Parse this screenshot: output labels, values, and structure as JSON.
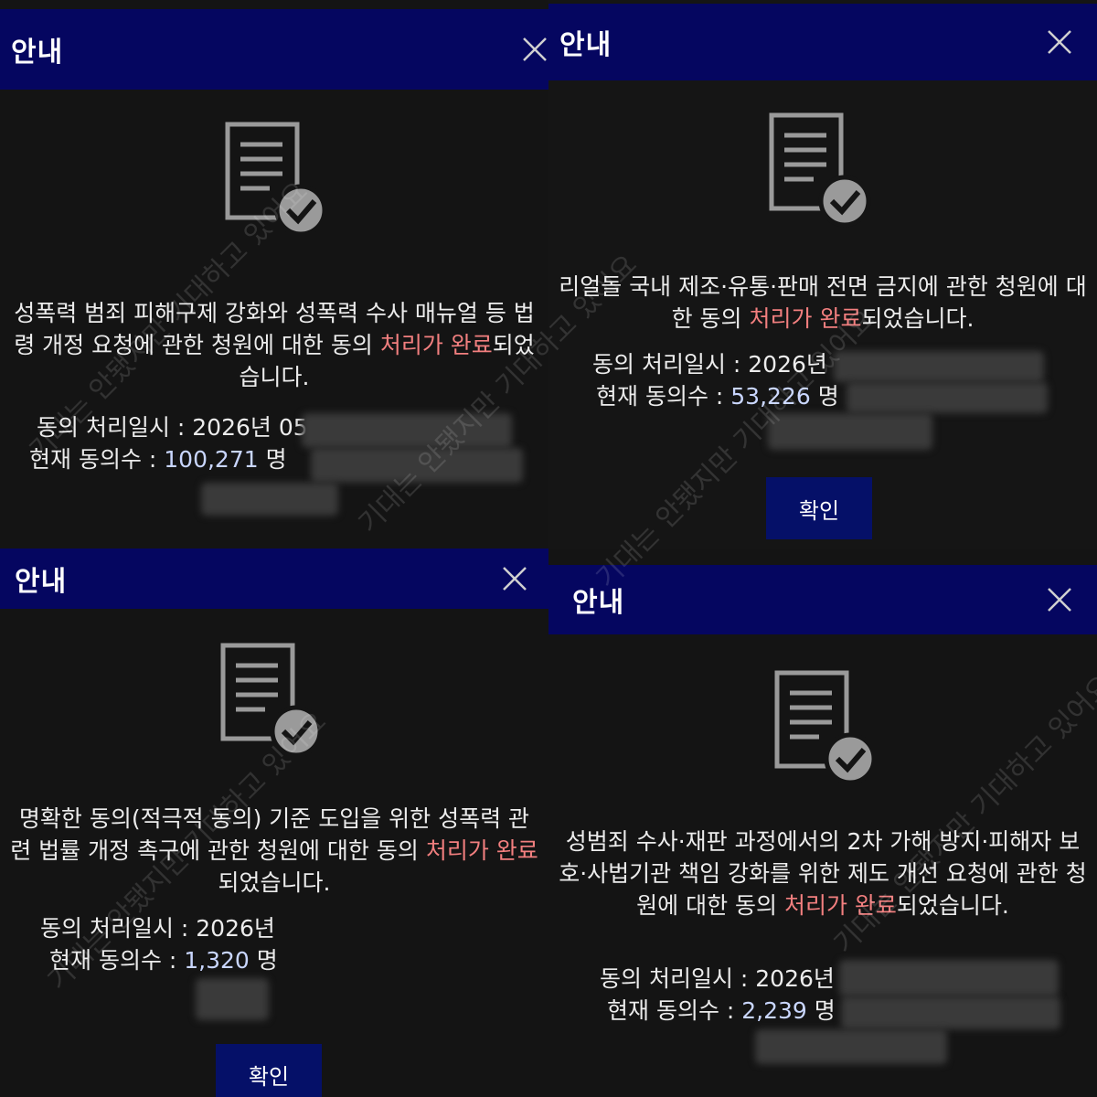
{
  "watermark_text": "기대는 안됐지만 기대하고 있어요",
  "panels": [
    {
      "title": "안내",
      "message_before": "성폭력 범죄 피해구제 강화와 성폭력 수사 매뉴얼 등 법령 개정 요청에 관한 청원에 대한 동의 ",
      "message_highlight": "처리가 완료",
      "message_after": "되었습니다.",
      "date_label": "동의 처리일시 : ",
      "date_value": "2026년 05",
      "count_label": "현재 동의수 : ",
      "count_value": "100,271",
      "count_unit": " 명"
    },
    {
      "title": "안내",
      "message_before": "리얼돌 국내 제조·유통·판매 전면 금지에 관한 청원에 대한 동의 ",
      "message_highlight": "처리가 완료",
      "message_after": "되었습니다.",
      "date_label": "동의 처리일시 : ",
      "date_value": "2026년",
      "count_label": "현재 동의수 : ",
      "count_value": "53,226",
      "count_unit": " 명",
      "button_label": "확인"
    },
    {
      "title": "안내",
      "message_before": "명확한 동의(적극적 동의) 기준 도입을 위한 성폭력 관련 법률 개정 촉구에 관한 청원에 대한 동의 ",
      "message_highlight": "처리가 완료",
      "message_after": "되었습니다.",
      "date_label": "동의 처리일시 : ",
      "date_value": "2026년",
      "count_label": "현재 동의수 : ",
      "count_value": "1,320",
      "count_unit": " 명",
      "button_label": "확인"
    },
    {
      "title": "안내",
      "message_before": "성범죄 수사·재판 과정에서의 2차 가해 방지·피해자 보호·사법기관 책임 강화를 위한 제도 개선 요청에 관한 청원에 대한 동의 ",
      "message_highlight": "처리가 완료",
      "message_after": "되었습니다.",
      "date_label": "동의 처리일시 : ",
      "date_value": "2026년",
      "count_label": "현재 동의수 : ",
      "count_value": "2,239",
      "count_unit": " 명"
    }
  ],
  "colors": {
    "header": "#050660",
    "highlight": "#f27f7f",
    "count": "#c9d6ff",
    "background": "#141414"
  },
  "icons": {
    "close": "close-icon",
    "document": "document-check-icon"
  }
}
